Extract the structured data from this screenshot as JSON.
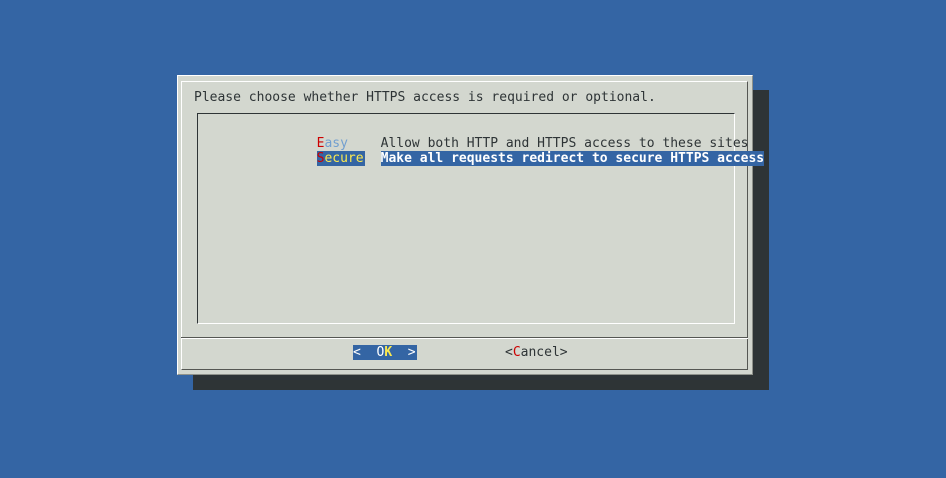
{
  "dialog": {
    "prompt": "Please choose whether HTTPS access is required or optional."
  },
  "menu": {
    "items": [
      {
        "tag_hotkey": "E",
        "tag_rest": "asy",
        "description": "Allow both HTTP and HTTPS access to these sites",
        "selected": false
      },
      {
        "tag_hotkey": "S",
        "tag_rest": "ecure",
        "description": "Make all requests redirect to secure HTTPS access",
        "selected": true
      }
    ]
  },
  "buttons": {
    "ok": {
      "left": "<  ",
      "pre": "O",
      "hot": "K",
      "right": "  >"
    },
    "cancel": {
      "left": "<",
      "hot": "C",
      "rest": "ancel",
      "right": ">"
    }
  },
  "colors": {
    "background": "#3465a4",
    "dialog": "#d3d7cf",
    "shadow": "#2e3436",
    "highlight": "#3465a4",
    "hotkey": "#cc0000",
    "selected_tag": "#fce94f"
  }
}
